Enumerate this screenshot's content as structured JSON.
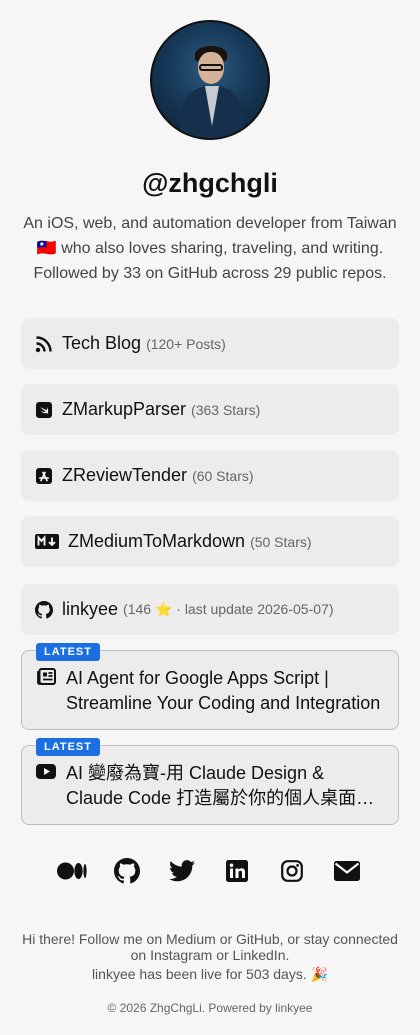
{
  "profile": {
    "handle": "@zhgchgli",
    "bio_line1": "An iOS, web, and automation developer from Taiwan",
    "bio_line2": "🇹🇼 who also loves sharing, traveling, and writing.",
    "bio_line3": "Followed by 33 on GitHub across 29 public repos."
  },
  "links": [
    {
      "title": "Tech Blog",
      "meta": "(120+ Posts)",
      "icon": "rss-icon"
    },
    {
      "title": "ZMarkupParser",
      "meta": "(363 Stars)",
      "icon": "swift-icon"
    },
    {
      "title": "ZReviewTender",
      "meta": "(60 Stars)",
      "icon": "app-store-icon"
    },
    {
      "title": "ZMediumToMarkdown",
      "meta": "(50 Stars)",
      "icon": "markdown-icon"
    },
    {
      "title": "linkyee",
      "meta": "(146 ⭐ · last update 2026-05-07)",
      "icon": "github-icon"
    }
  ],
  "latest": [
    {
      "badge": "LATEST",
      "icon": "article-icon",
      "text": "AI Agent for Google Apps Script | Streamline Your Coding and Integration"
    },
    {
      "badge": "LATEST",
      "icon": "youtube-icon",
      "text": "AI 變廢為寶-用 Claude Design & Claude Code 打造屬於你的個人桌面小工具"
    }
  ],
  "socials": [
    "medium-icon",
    "github-icon",
    "twitter-icon",
    "linkedin-icon",
    "instagram-icon",
    "mail-icon"
  ],
  "footer": {
    "message": "Hi there! Follow me on Medium or GitHub, or stay connected on Instagram or LinkedIn.",
    "live": "linkyee has been live for 503 days. 🎉",
    "copyright": "© 2026 ZhgChgLi. Powered by linkyee"
  },
  "colors": {
    "badge": "#1b6fe0",
    "card_bg": "#ececec",
    "page_bg": "#f6f6f6"
  }
}
